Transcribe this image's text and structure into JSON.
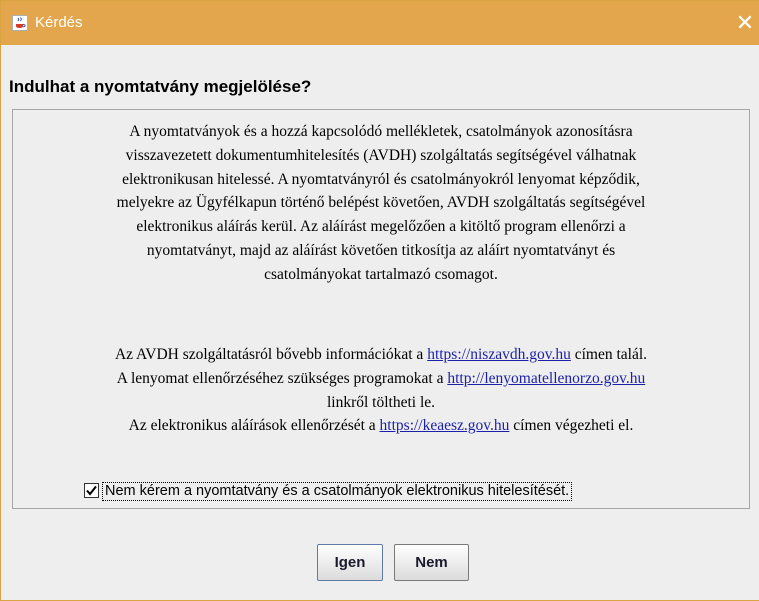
{
  "window": {
    "title": "Kérdés",
    "title_icon": "java-cup-icon",
    "close_glyph": "✕",
    "colors": {
      "titlebar": "#e3a64c",
      "link": "#1c1fa8",
      "background": "#eeeeee"
    }
  },
  "dialog": {
    "question": "Indulhat a nyomtatvány megjelölése?",
    "paragraph1_lines": [
      "A nyomtatványok és a hozzá kapcsolódó mellékletek, csatolmányok azonosításra",
      "visszavezetett dokumentumhitelesítés (AVDH) szolgáltatás segítségével válhatnak",
      "elektronikusan hitelessé. A nyomtatványról és csatolmányokról lenyomat képződik,",
      "melyekre az Ügyfélkapun történő belépést követően, AVDH szolgáltatás segítségével",
      "elektronikus aláírás kerül. Az aláírást megelőzően a kitöltő program ellenőrzi a",
      "nyomtatványt, majd az aláírást követően titkosítja az aláírt nyomtatványt és",
      "csatolmányokat tartalmazó csomagot."
    ],
    "info": {
      "line1_before": "Az AVDH szolgáltatásról bővebb információkat a",
      "line1_link": "https://niszavdh.gov.hu",
      "line1_after": "címen talál.",
      "line2_before": "A lenyomat ellenőrzéséhez szükséges programokat a",
      "line2_link": "http://lenyomatellenorzo.gov.hu",
      "line3": "linkről töltheti le.",
      "line4_before": "Az elektronikus aláírások ellenőrzését a",
      "line4_link": "https://keaesz.gov.hu",
      "line4_after": "címen végezheti el."
    },
    "checkbox": {
      "checked": true,
      "label": "Nem kérem a nyomtatvány és a csatolmányok elektronikus hitelesítését."
    },
    "buttons": {
      "yes": "Igen",
      "no": "Nem"
    }
  }
}
